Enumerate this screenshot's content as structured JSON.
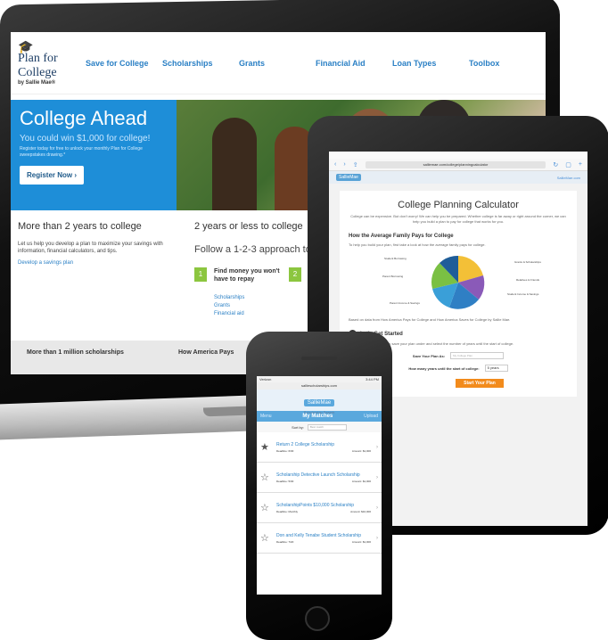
{
  "laptop": {
    "logo": {
      "name": "Plan for College",
      "by": "by Sallie Mae®"
    },
    "nav": [
      "Save for College",
      "Scholarships",
      "Grants",
      "Financial Aid",
      "Loan Types",
      "Toolbox"
    ],
    "hero": {
      "title": "College Ahead",
      "subtitle": "You could win $1,000 for college!",
      "fine": "Register today for free to unlock your monthly Plan for College sweepstakes drawing.*",
      "button": "Register Now ›"
    },
    "left": {
      "heading": "More than 2 years to college",
      "text": "Let us help you develop a plan to maximize your savings with information, financial calculators, and tips.",
      "link": "Develop a savings plan"
    },
    "right": {
      "heading": "2 years or less to college",
      "follow": "Follow a 1-2-3 approach to payi",
      "step1_num": "1",
      "step1": "Find money you won't have to repay",
      "step2_num": "2",
      "links": [
        "Scholarships",
        "Grants",
        "Financial aid"
      ]
    },
    "bottom": {
      "left": "More than 1 million scholarships",
      "right": "How America Pays"
    }
  },
  "tablet": {
    "url": "salliemae.com/college/planningcalculator",
    "logo": "SallieMae",
    "header_link": "SallieMae.com",
    "title": "College Planning Calculator",
    "subtitle": "College can be expensive. But don't worry! We can help you be prepared. Whether college is far away or right around the corner, we can help you build a plan to pay for college that works for you.",
    "section": "How the Average Family Pays for College",
    "section_text": "To help you build your plan, first take a look at how the average family pays for college.",
    "pie_labels": {
      "a": "Student Borrowing",
      "b": "Parent Borrowing",
      "c": "Grants & Scholarships",
      "d": "Relatives & Friends",
      "e": "Student Income & Savings",
      "f": "Parent Income & Savings"
    },
    "source": "Based on data from How America Pays for College and How America Saves for College by Sallie Mae.",
    "start_heading": "Let's Get Started",
    "start_text": "To begin, create a name to save your plan under and select the number of years until the start of college.",
    "save_label": "Save Your Plan As:",
    "save_placeholder": "My College Plan",
    "years_label": "How many years until the start of college:",
    "years_value": "5 years",
    "button": "Start Your Plan",
    "colors": {
      "slice1": "#f3c037",
      "slice2": "#8a5ab8",
      "slice3": "#2f7fc4",
      "slice4": "#3a9fd8",
      "slice5": "#7ac043",
      "slice6": "#1f5d99"
    }
  },
  "phone": {
    "status": {
      "carrier": "Verizon",
      "time": "3:44 PM"
    },
    "url": "salliescholarships.com",
    "logo": "SallieMae",
    "search_title": "Scholarship Search",
    "tabs": {
      "left": "Menu",
      "center": "My Matches",
      "right": "Upload"
    },
    "sort_label": "Sort by:",
    "sort_value": "Best match",
    "items": [
      {
        "name": "Return 2 College Scholarship",
        "deadline": "Deadline: 6/30",
        "amount": "Amount: $1,000",
        "star": "★"
      },
      {
        "name": "Scholarship Detective Launch Scholarship",
        "deadline": "Deadline: 5/30",
        "amount": "Amount: $1,000",
        "star": "☆"
      },
      {
        "name": "ScholarshipPoints $10,000 Scholarship",
        "deadline": "Deadline: Monthly",
        "amount": "Amount: $10,000",
        "star": "☆"
      },
      {
        "name": "Don and Kelly Tenabe Student Scholarship",
        "deadline": "Deadline: 7/20",
        "amount": "Amount: $1,000",
        "star": "☆"
      }
    ]
  }
}
